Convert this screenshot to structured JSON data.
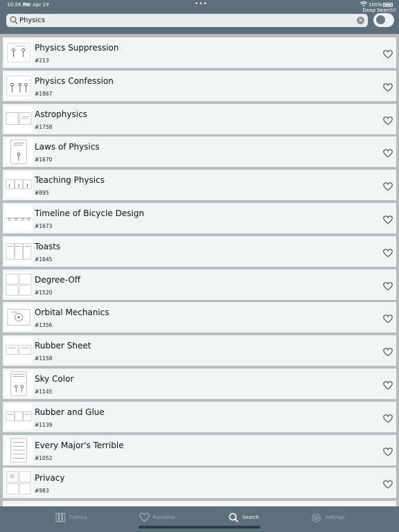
{
  "status_bar": {
    "time": "10:26 PM",
    "date": "Tue Apr 19",
    "dots": "•••",
    "battery_percent": "100%"
  },
  "deep_search": {
    "label": "Deep Search?",
    "enabled": true
  },
  "search": {
    "value": "Physics",
    "placeholder": ""
  },
  "results": [
    {
      "title": "Physics Suppression",
      "number": "#213"
    },
    {
      "title": "Physics Confession",
      "number": "#1867"
    },
    {
      "title": "Astrophysics",
      "number": "#1758"
    },
    {
      "title": "Laws of Physics",
      "number": "#1670"
    },
    {
      "title": "Teaching Physics",
      "number": "#895"
    },
    {
      "title": "Timeline of Bicycle Design",
      "number": "#1673"
    },
    {
      "title": "Toasts",
      "number": "#1645"
    },
    {
      "title": "Degree-Off",
      "number": "#1520"
    },
    {
      "title": "Orbital Mechanics",
      "number": "#1356"
    },
    {
      "title": "Rubber Sheet",
      "number": "#1158"
    },
    {
      "title": "Sky Color",
      "number": "#1145"
    },
    {
      "title": "Rubber and Glue",
      "number": "#1139"
    },
    {
      "title": "Every Major's Terrible",
      "number": "#1052"
    },
    {
      "title": "Privacy",
      "number": "#983"
    }
  ],
  "tabs": [
    {
      "label": "Comics",
      "icon": "comics-icon"
    },
    {
      "label": "Favorites",
      "icon": "heart-icon"
    },
    {
      "label": "Search",
      "icon": "search-icon",
      "active": true
    },
    {
      "label": "Settings",
      "icon": "gear-icon"
    }
  ],
  "colors": {
    "bar": "#5d6f7b",
    "row": "#f3f4f4",
    "separator": "#b9bcbd",
    "active_tab": "#ffffff",
    "inactive_tab": "#a9b2b8"
  }
}
